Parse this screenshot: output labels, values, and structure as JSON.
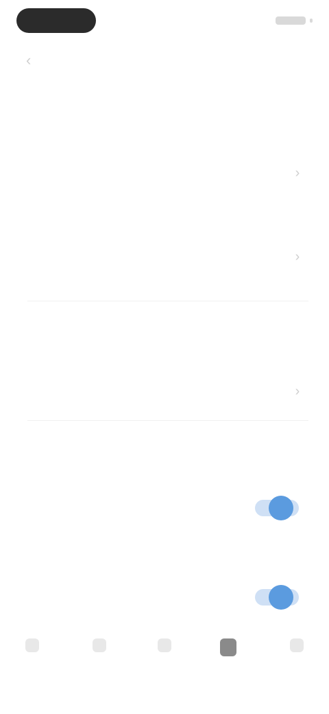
{
  "status_bar": {
    "pill_text": "",
    "battery_label": ""
  },
  "header": {
    "title": "",
    "back_icon": "chevron-left-icon"
  },
  "sections": {
    "top_label": "",
    "top_description": "",
    "row1": {
      "title": "",
      "subtitle": ""
    },
    "row2": {
      "title": "",
      "subtitle": ""
    },
    "mid_label": "",
    "mid_description": "",
    "row3": {
      "title": ""
    },
    "lower_label": "",
    "toggle1": {
      "title": "",
      "subtitle": "",
      "enabled": true
    },
    "toggle2": {
      "title": "",
      "subtitle": "",
      "enabled": true
    }
  },
  "bottom_nav": {
    "items": [
      {
        "label": "",
        "icon": "home-icon"
      },
      {
        "label": "",
        "icon": "search-icon"
      },
      {
        "label": "",
        "icon": "add-icon"
      },
      {
        "label": "",
        "icon": "profile-icon",
        "active": true
      },
      {
        "label": "",
        "icon": "settings-icon"
      }
    ]
  },
  "colors": {
    "accent": "#5b9bdf",
    "accent_track": "#cfe0f5",
    "divider": "#f0f0f0"
  }
}
